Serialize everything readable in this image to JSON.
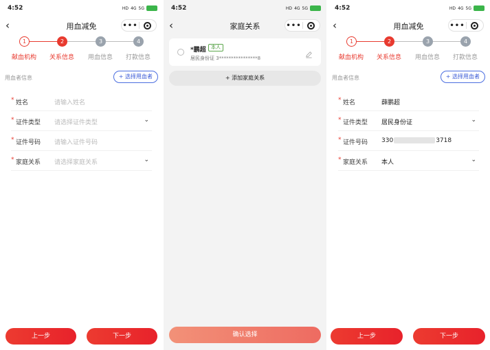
{
  "screens": [
    {
      "status_time": "4:52",
      "nav_title": "用血减免",
      "steps": [
        {
          "num": "1",
          "label": "献血机构"
        },
        {
          "num": "2",
          "label": "关系信息"
        },
        {
          "num": "3",
          "label": "用血信息"
        },
        {
          "num": "4",
          "label": "打款信息"
        }
      ],
      "section_title": "用血者信息",
      "choose_label": "+ 选择用血者",
      "fields": [
        {
          "label": "姓名",
          "placeholder": "请输入姓名"
        },
        {
          "label": "证件类型",
          "placeholder": "请选择证件类型"
        },
        {
          "label": "证件号码",
          "placeholder": "请输入证件号码"
        },
        {
          "label": "家庭关系",
          "placeholder": "请选择家庭关系"
        }
      ],
      "prev_label": "上一步",
      "next_label": "下一步"
    },
    {
      "status_time": "4:52",
      "nav_title": "家庭关系",
      "card": {
        "name": "*鹏超",
        "tag": "本人",
        "id_line": "居民身份证  3****************8"
      },
      "add_label": "+ 添加家庭关系",
      "confirm_label": "确认选择"
    },
    {
      "status_time": "4:52",
      "nav_title": "用血减免",
      "steps": [
        {
          "num": "1",
          "label": "献血机构"
        },
        {
          "num": "2",
          "label": "关系信息"
        },
        {
          "num": "3",
          "label": "用血信息"
        },
        {
          "num": "4",
          "label": "打款信息"
        }
      ],
      "section_title": "用血者信息",
      "choose_label": "+ 选择用血者",
      "fields": [
        {
          "label": "姓名",
          "value": "薛鹏超"
        },
        {
          "label": "证件类型",
          "value": "居民身份证"
        },
        {
          "label": "证件号码",
          "value_start": "330",
          "value_end": "3718"
        },
        {
          "label": "家庭关系",
          "value": "本人"
        }
      ],
      "prev_label": "上一步",
      "next_label": "下一步"
    }
  ],
  "status_icons": {
    "network_4g": "4G",
    "network_5g": "5G",
    "hd": "HD"
  },
  "colors": {
    "accent": "#e83a2f",
    "link": "#3b5bd6",
    "tag_green": "#4e9a3e",
    "inactive_step": "#9aa3ad"
  }
}
